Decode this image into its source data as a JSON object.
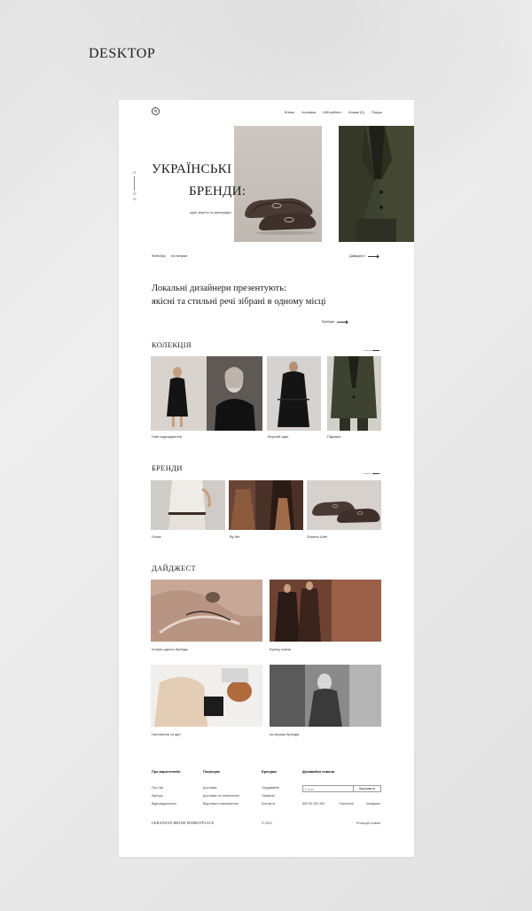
{
  "showcase": {
    "title": "DESKTOP"
  },
  "header": {
    "logo_glyph": "✲",
    "nav": [
      "Жінки",
      "Чоловіки",
      "Мій кабінет",
      "Кошик (0)",
      "Пошук"
    ]
  },
  "hero": {
    "title_line1": "УКРАЇНСЬКІ",
    "title_line2": "БРЕНДИ:",
    "subtitle": "одяг, взуття та аксесуари",
    "slider": {
      "current": "01",
      "next": "02",
      "last": "03"
    },
    "social": [
      "Фейсбук",
      "Інстаграм"
    ],
    "digest_link": "Дайджест"
  },
  "intro": {
    "line1": "Локальні дизайнери презентують:",
    "line2": "якісні та стильні речі зібрані в одному місці",
    "link": "Бренди"
  },
  "collection": {
    "title": "КОЛЕКЦІЯ",
    "items": [
      "Нові надходження",
      "Верхній одяг",
      "Піджаки"
    ]
  },
  "brands": {
    "title": "БРЕНДИ",
    "items": [
      "Grass",
      "By Me",
      "Zhanna Uder"
    ]
  },
  "digest": {
    "title": "ДАЙДЖЕСТ",
    "items": [
      "Історія одного бренда",
      "Бренд тижня",
      "Натхнення та ідеї",
      "Інстаграм брендів"
    ]
  },
  "footer": {
    "col1": {
      "heading": "Про маркетплейс",
      "links": [
        "Про нас",
        "Кар'єра",
        "Відповідальність"
      ]
    },
    "col2": {
      "heading": "Покупцям",
      "links": [
        "Доставка",
        "Доставка та повернення",
        "Відстежити замовлення"
      ]
    },
    "col3": {
      "heading": "Брендам",
      "links": [
        "Продавайте",
        "Правила",
        "Контакти"
      ]
    },
    "newsletter": {
      "heading": "Дізнавайся новини",
      "placeholder": "E-mail",
      "button": "Відправити",
      "phone": "800 00 000 300",
      "facebook": "Facebook",
      "instagram": "Instagram"
    },
    "brand": "UKRAINIAN BRAND MARKETPLACE",
    "copyright": "© 2019",
    "privacy": "Privacy&Cookies"
  },
  "colors": {
    "olive": "#3b3f2a",
    "shoe": "#4a3a34",
    "background": "#ebebeb"
  }
}
